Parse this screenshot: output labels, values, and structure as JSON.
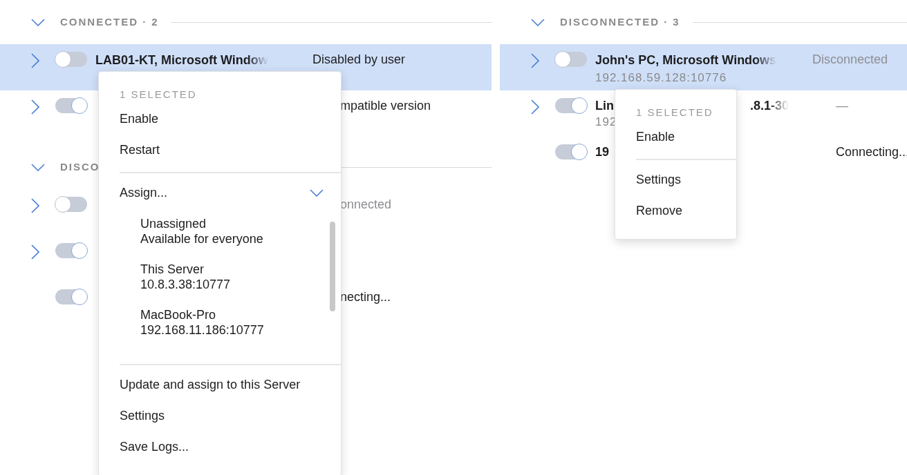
{
  "panels": [
    {
      "sections": [
        {
          "label": "CONNECTED · 2",
          "expanded": true,
          "rows": [
            {
              "kind": "full",
              "expandable": true,
              "selected": true,
              "on": false,
              "name": "LAB01-KT, Microsoft Window",
              "status": "Disabled by user",
              "status_muted": false
            },
            {
              "kind": "partial",
              "expandable": true,
              "selected": false,
              "on": true,
              "status": "mpatible version",
              "status_muted": false
            }
          ]
        },
        {
          "label": "DISCO",
          "expanded": true,
          "rows": [
            {
              "kind": "partial",
              "expandable": true,
              "selected": false,
              "on": false,
              "status": "onnected",
              "status_muted": true
            },
            {
              "kind": "partial",
              "expandable": true,
              "selected": false,
              "on": true
            },
            {
              "kind": "partial",
              "expandable": false,
              "selected": false,
              "on": true,
              "status": "necting...",
              "status_muted": false
            }
          ]
        }
      ],
      "menu": {
        "items": [
          {
            "kind": "header",
            "text": "1 SELECTED"
          },
          {
            "kind": "item",
            "text": "Enable"
          },
          {
            "kind": "item",
            "text": "Restart"
          },
          {
            "kind": "divider"
          },
          {
            "kind": "submenu",
            "text": "Assign...",
            "expanded": true,
            "options": [
              {
                "title": "Unassigned",
                "subtitle": "Available for everyone"
              },
              {
                "title": "This Server",
                "subtitle": "10.8.3.38:10777"
              },
              {
                "title": "MacBook-Pro",
                "subtitle": "192.168.11.186:10777"
              }
            ]
          },
          {
            "kind": "divider"
          },
          {
            "kind": "item",
            "text": "Update and assign to this Server"
          },
          {
            "kind": "item",
            "text": "Settings"
          },
          {
            "kind": "item",
            "text": "Save Logs..."
          }
        ]
      }
    },
    {
      "sections": [
        {
          "label": "DISCONNECTED · 3",
          "expanded": true,
          "rows": [
            {
              "kind": "full",
              "expandable": true,
              "selected": true,
              "on": false,
              "name": "John's PC, Microsoft Windows",
              "address": "192.168.59.128:10776",
              "status": "Disconnected",
              "status_muted": true
            },
            {
              "kind": "partial",
              "expandable": true,
              "selected": false,
              "on": true,
              "head": "Lin",
              "tail": ".8.1-30",
              "address_head": "192",
              "status": "—",
              "status_muted": true
            },
            {
              "kind": "partial",
              "expandable": false,
              "selected": false,
              "on": true,
              "head": "19",
              "status": "Connecting...",
              "status_muted": false
            }
          ]
        }
      ],
      "menu": {
        "items": [
          {
            "kind": "header",
            "text": "1 SELECTED"
          },
          {
            "kind": "item",
            "text": "Enable"
          },
          {
            "kind": "divider"
          },
          {
            "kind": "item",
            "text": "Settings"
          },
          {
            "kind": "item",
            "text": "Remove"
          }
        ]
      }
    }
  ]
}
